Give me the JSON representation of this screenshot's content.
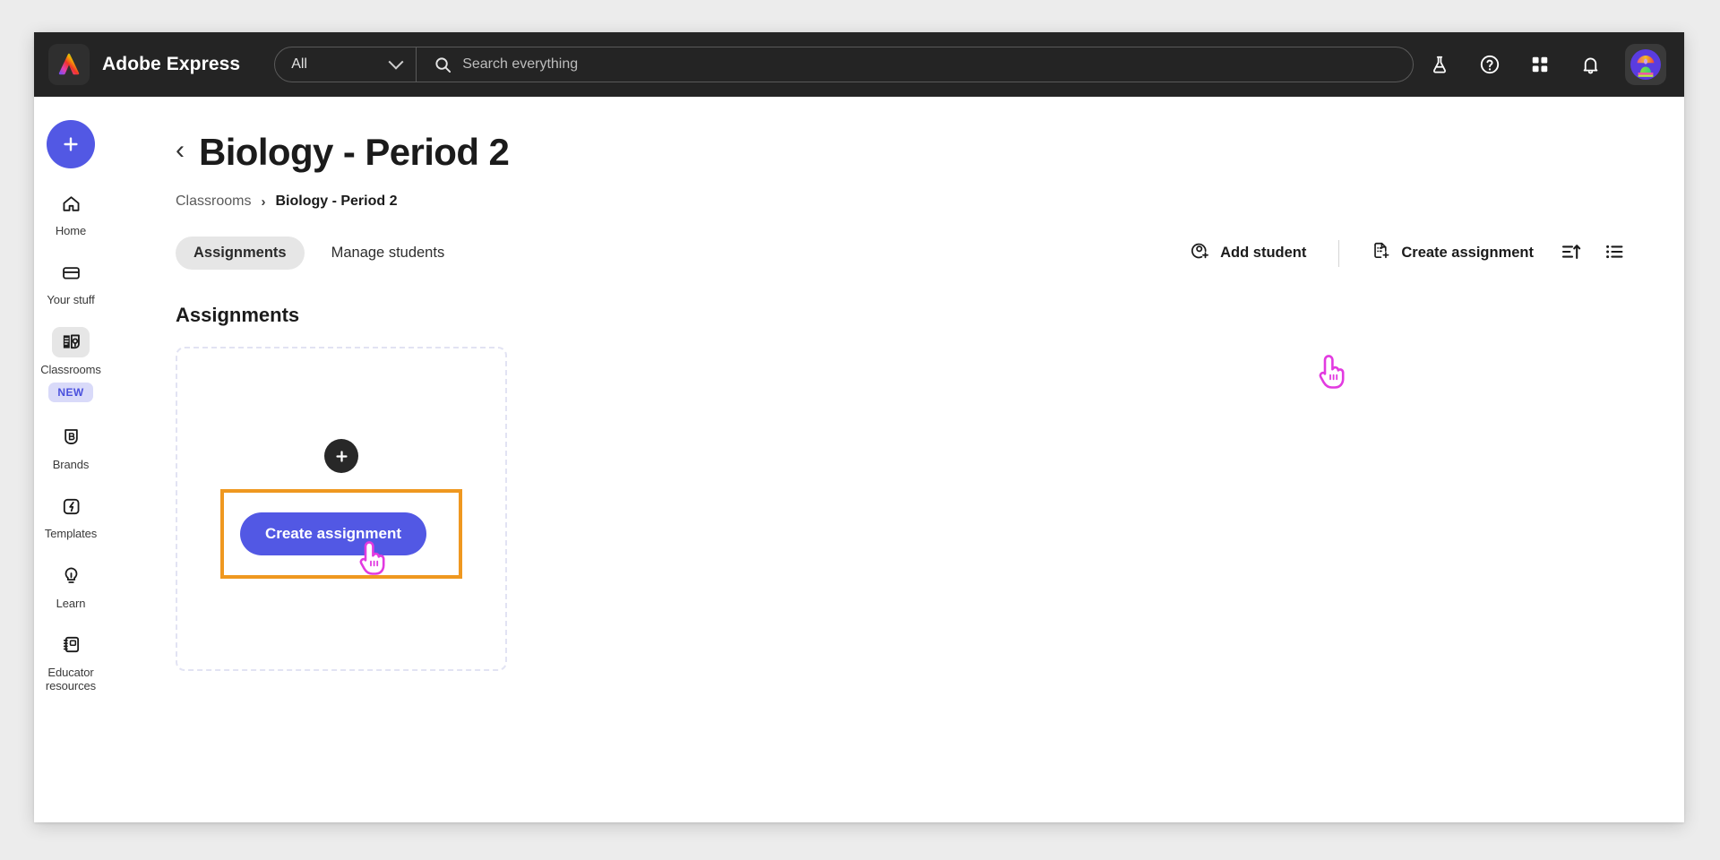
{
  "topbar": {
    "logo_icon": "adobe-express-logo-icon",
    "brand": "Adobe Express",
    "scope": {
      "value": "All",
      "icon": "chevron-down-icon"
    },
    "search": {
      "placeholder": "Search everything",
      "value": "",
      "icon": "search-icon"
    },
    "actions": [
      {
        "name": "beta-flask-icon",
        "glyph": "flask"
      },
      {
        "name": "help-icon",
        "glyph": "question"
      },
      {
        "name": "apps-grid-icon",
        "glyph": "grid"
      },
      {
        "name": "notifications-bell-icon",
        "glyph": "bell"
      }
    ],
    "avatar": {
      "name": "user-avatar",
      "alt": "User avatar"
    }
  },
  "sidebar": {
    "create_button": {
      "label": "+",
      "name": "create-new-button"
    },
    "items": [
      {
        "label": "Home",
        "icon": "home-icon",
        "active": false
      },
      {
        "label": "Your stuff",
        "icon": "folder-icon",
        "active": false
      },
      {
        "label": "Classrooms",
        "icon": "classrooms-icon",
        "active": true,
        "badge": "NEW"
      },
      {
        "label": "Brands",
        "icon": "brand-shield-icon",
        "active": false
      },
      {
        "label": "Templates",
        "icon": "templates-icon",
        "active": false
      },
      {
        "label": "Learn",
        "icon": "lightbulb-icon",
        "active": false
      },
      {
        "label": "Educator resources",
        "icon": "notebook-icon",
        "active": false
      }
    ]
  },
  "main": {
    "back_label": "‹",
    "title": "Biology - Period 2",
    "breadcrumb": {
      "root": "Classrooms",
      "separator": "›",
      "current": "Biology - Period 2"
    },
    "tabs": [
      {
        "label": "Assignments",
        "active": true
      },
      {
        "label": "Manage students",
        "active": false
      }
    ],
    "toolbar": {
      "add_student": {
        "label": "Add student",
        "icon": "add-student-icon"
      },
      "create_assignment": {
        "label": "Create assignment",
        "icon": "create-assignment-icon"
      },
      "sort": {
        "icon": "sort-ascending-icon"
      },
      "view": {
        "icon": "list-view-icon"
      }
    },
    "section_heading": "Assignments",
    "empty_card": {
      "plus_icon": "plus-circle-icon",
      "cta_label": "Create assignment"
    }
  },
  "colors": {
    "accent_indigo": "#5258e4",
    "highlight_orange": "#ef9820",
    "cursor_magenta": "#e040e0",
    "topbar_dark": "#242424",
    "badge_bg": "#d9daf9",
    "badge_text": "#4a50dd"
  }
}
